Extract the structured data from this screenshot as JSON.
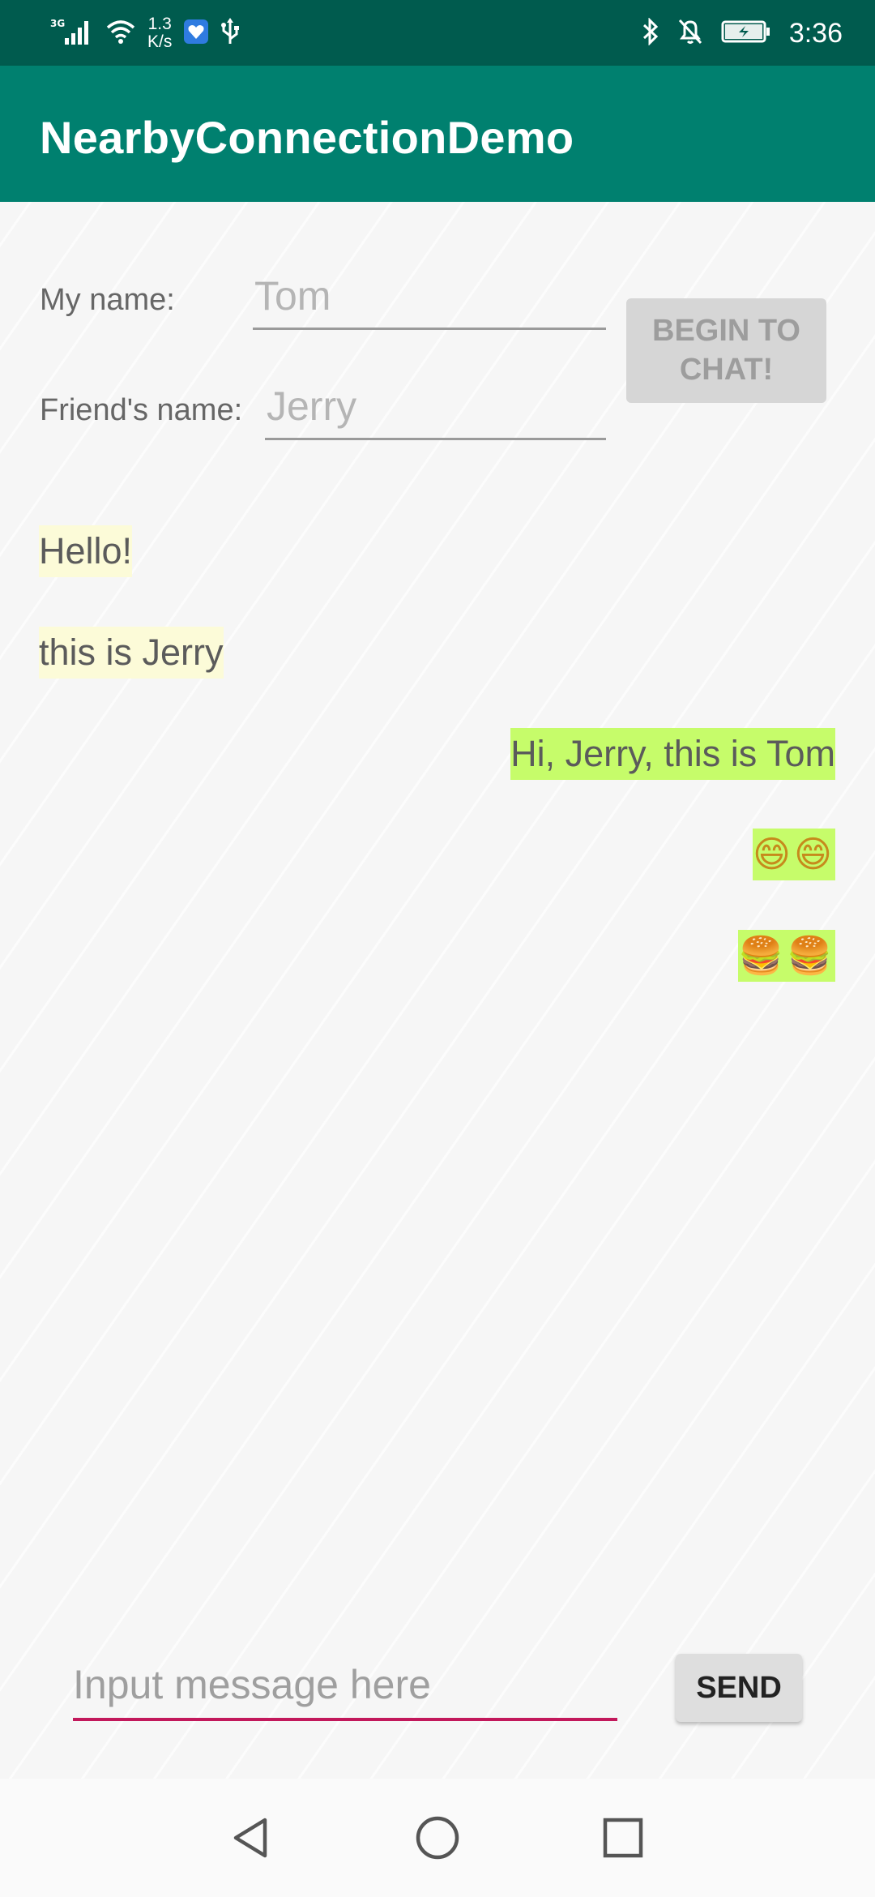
{
  "status_bar": {
    "network_type": "3G",
    "speed_value": "1.3",
    "speed_unit": "K/s",
    "time": "3:36",
    "icons": [
      "signal-icon",
      "wifi-icon",
      "app-notification-icon",
      "usb-icon",
      "bluetooth-icon",
      "notifications-off-icon",
      "battery-charging-icon"
    ]
  },
  "app_bar": {
    "title": "NearbyConnectionDemo"
  },
  "setup": {
    "my_name_label": "My name:",
    "my_name_value": "Tom",
    "friend_name_label": "Friend's name:",
    "friend_name_value": "Jerry",
    "begin_button_line1": "BEGIN TO",
    "begin_button_line2": "CHAT!"
  },
  "messages": [
    {
      "direction": "incoming",
      "text": "Hello!"
    },
    {
      "direction": "incoming",
      "text": "this is Jerry"
    },
    {
      "direction": "outgoing",
      "text": "Hi, Jerry, this is Tom"
    },
    {
      "direction": "outgoing",
      "text": "😄😄"
    },
    {
      "direction": "outgoing",
      "text": "🍔🍔"
    }
  ],
  "composer": {
    "placeholder": "Input message here",
    "send_label": "SEND"
  },
  "colors": {
    "status_bar": "#005b4e",
    "app_bar": "#00806f",
    "incoming_bubble": "#fcfbd8",
    "outgoing_bubble": "#c6fc6a",
    "input_underline": "#c2185b"
  },
  "nav_bar": {
    "icons": [
      "back-icon",
      "home-icon",
      "recents-icon"
    ]
  }
}
